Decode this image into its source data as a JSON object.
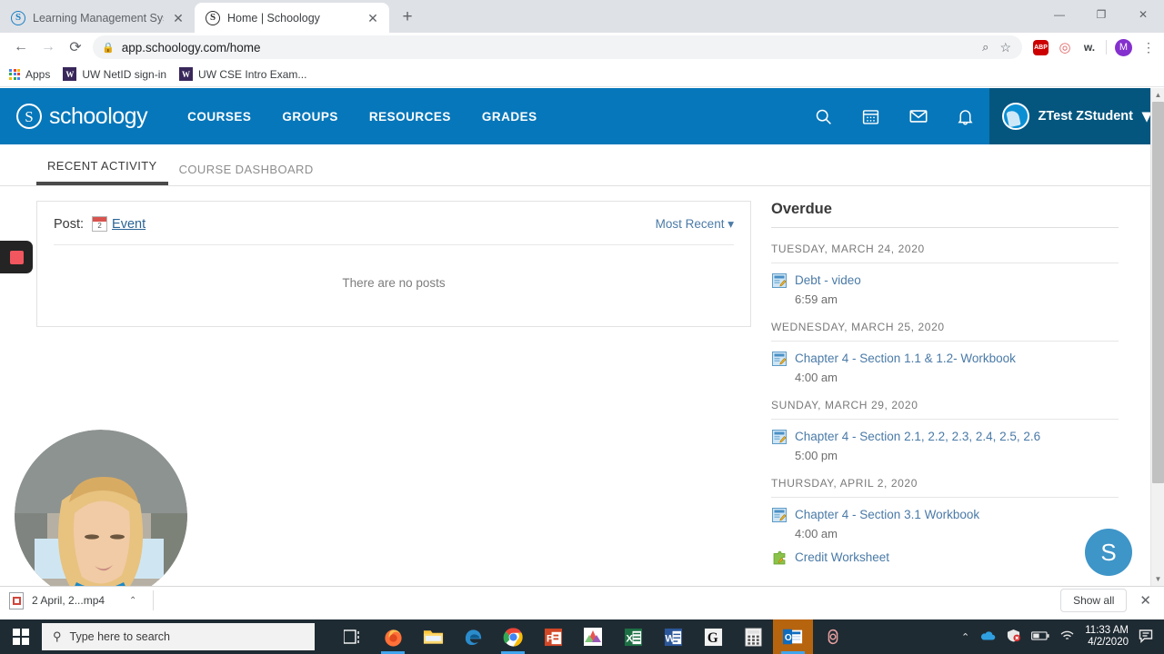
{
  "browser": {
    "tabs": [
      {
        "title": "Learning Management System | L",
        "favicon": "schoology-favicon",
        "active": false,
        "close": "✕"
      },
      {
        "title": "Home | Schoology",
        "favicon": "schoology-favicon",
        "active": true,
        "close": "✕"
      }
    ],
    "new_tab_label": "+",
    "window_controls": {
      "minimize": "—",
      "maximize": "❐",
      "close": "✕"
    },
    "nav": {
      "back": "←",
      "forward": "→",
      "reload": "⟳"
    },
    "omnibox": {
      "url": "app.schoology.com/home",
      "lock_icon": "lock-icon",
      "zoom_icon": "zoom-in-icon",
      "bookmark_icon": "star-icon"
    },
    "extensions": [
      {
        "name": "adblock-plus",
        "label": "ABP",
        "color": "#cc0000"
      },
      {
        "name": "openai-extension",
        "label": "◎",
        "color": "#e06a6a"
      },
      {
        "name": "wikiwand-extension",
        "label": "w.",
        "color": "#3c4043"
      }
    ],
    "profile_avatar": "M",
    "menu_icon": "⋮",
    "bookmarks": [
      {
        "label": "Apps",
        "icon": "apps-grid-icon"
      },
      {
        "label": "UW NetID sign-in",
        "icon": "uw-w-icon"
      },
      {
        "label": "UW CSE Intro Exam...",
        "icon": "uw-w-icon"
      }
    ]
  },
  "schoology": {
    "brand": {
      "name": "schoology",
      "trademark": "®",
      "mark": "S"
    },
    "nav": [
      "COURSES",
      "GROUPS",
      "RESOURCES",
      "GRADES"
    ],
    "header_icons": [
      {
        "name": "search-icon"
      },
      {
        "name": "calendar-icon"
      },
      {
        "name": "messages-icon"
      },
      {
        "name": "notifications-icon"
      }
    ],
    "user": {
      "name": "ZTest ZStudent",
      "caret": "⌄"
    },
    "tabs": [
      {
        "label": "RECENT ACTIVITY",
        "active": true
      },
      {
        "label": "COURSE DASHBOARD",
        "active": false
      }
    ],
    "post": {
      "prefix": "Post:",
      "event_link": "Event",
      "event_icon_day": "2",
      "sort_label": "Most Recent",
      "sort_caret": "▾",
      "empty_message": "There are no posts"
    },
    "overdue": {
      "title": "Overdue",
      "groups": [
        {
          "date": "TUESDAY, MARCH 24, 2020",
          "items": [
            {
              "name": "Debt - video",
              "time": "6:59 am",
              "icon": "assignment-icon"
            }
          ]
        },
        {
          "date": "WEDNESDAY, MARCH 25, 2020",
          "items": [
            {
              "name": "Chapter 4 - Section 1.1 & 1.2- Workbook",
              "time": "4:00 am",
              "icon": "assignment-icon"
            }
          ]
        },
        {
          "date": "SUNDAY, MARCH 29, 2020",
          "items": [
            {
              "name": "Chapter 4 - Section 2.1, 2.2, 2.3, 2.4, 2.5, 2.6",
              "time": "5:00 pm",
              "icon": "assignment-icon"
            }
          ]
        },
        {
          "date": "THURSDAY, APRIL 2, 2020",
          "items": [
            {
              "name": "Chapter 4 - Section 3.1 Workbook",
              "time": "4:00 am",
              "icon": "assignment-icon"
            },
            {
              "name": "Credit Worksheet",
              "time": "",
              "icon": "quiz-icon"
            }
          ]
        }
      ]
    },
    "support_bubble": "S",
    "accent_color": "#0677ba",
    "link_color": "#4a7aa7"
  },
  "downloads": {
    "file_name": "2 April, 2...mp4",
    "caret": "⌃",
    "show_all": "Show all",
    "close": "✕"
  },
  "taskbar": {
    "search_placeholder": "Type here to search",
    "search_icon": "magnifier-icon",
    "start_icon": "windows-logo-icon",
    "apps": [
      {
        "name": "task-view-icon",
        "glyph": "❐",
        "color": "#ffffff",
        "open": false,
        "highlight": false
      },
      {
        "name": "firefox-icon",
        "glyph": "●",
        "color": "#ff7139",
        "open": true,
        "highlight": false
      },
      {
        "name": "file-explorer-icon",
        "glyph": "■",
        "color": "#ffc83d",
        "open": false,
        "highlight": false
      },
      {
        "name": "microsoft-edge-icon",
        "glyph": "e",
        "color": "#1a9ed9",
        "open": false,
        "highlight": false
      },
      {
        "name": "google-chrome-icon",
        "glyph": "●",
        "color": "#4285f4",
        "open": true,
        "highlight": false
      },
      {
        "name": "powerpoint-icon",
        "glyph": "P",
        "color": "#d24726",
        "open": false,
        "highlight": false
      },
      {
        "name": "paint-3d-icon",
        "glyph": "▲",
        "color": "#b0399b",
        "open": false,
        "highlight": false
      },
      {
        "name": "excel-icon",
        "glyph": "X",
        "color": "#1d7044",
        "open": false,
        "highlight": false
      },
      {
        "name": "word-icon",
        "glyph": "W",
        "color": "#2b579a",
        "open": false,
        "highlight": false
      },
      {
        "name": "grammarly-icon",
        "glyph": "G",
        "color": "#222222",
        "open": false,
        "highlight": false
      },
      {
        "name": "calculator-icon",
        "glyph": "⊞",
        "color": "#f0f0f0",
        "open": false,
        "highlight": false
      },
      {
        "name": "outlook-icon",
        "glyph": "O",
        "color": "#0f6cbd",
        "open": true,
        "highlight": true
      },
      {
        "name": "openai-icon",
        "glyph": "◎",
        "color": "#e8a0a0",
        "open": false,
        "highlight": false
      }
    ],
    "tray": {
      "expand": "⌃",
      "icons": [
        "onedrive-icon",
        "antivirus-icon",
        "battery-icon",
        "wifi-icon"
      ],
      "time": "11:33 AM",
      "date": "4/2/2020",
      "action_center": "notification-icon"
    }
  },
  "overlays": {
    "recorder_stop": "stop-recording-button",
    "webcam": "webcam-bubble"
  }
}
